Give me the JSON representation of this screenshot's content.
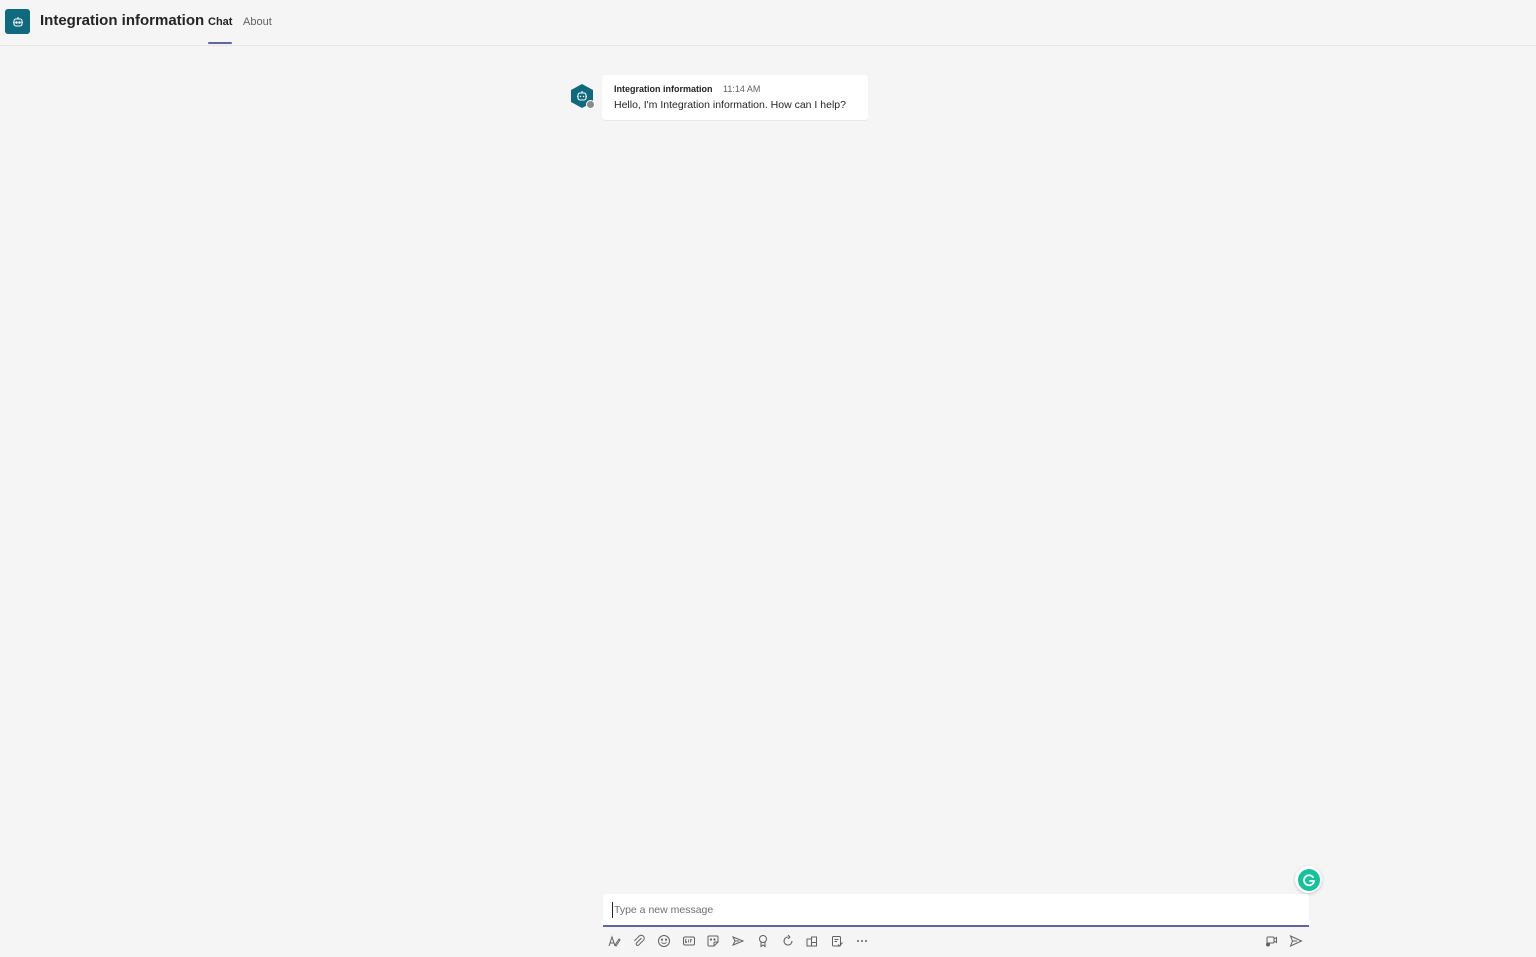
{
  "app": {
    "title": "Integration information",
    "icon": "bot-icon",
    "accent_color": "#0f6a7e"
  },
  "tabs": [
    {
      "label": "Chat",
      "active": true
    },
    {
      "label": "About",
      "active": false
    }
  ],
  "messages": [
    {
      "sender": "Integration information",
      "time": "11:14 AM",
      "text": "Hello, I'm Integration information. How can I help?",
      "avatar_icon": "bot-icon",
      "presence": "offline"
    }
  ],
  "compose": {
    "placeholder": "Type a new message",
    "value": "",
    "focus_color": "#6264a7"
  },
  "toolbar": {
    "left_icons": [
      "format-icon",
      "attach-icon",
      "emoji-icon",
      "gif-icon",
      "sticker-icon",
      "meet-now-icon",
      "praise-icon",
      "loop-icon",
      "apps-icon",
      "approvals-icon",
      "more-icon"
    ],
    "right_icons": [
      "video-clip-icon",
      "send-icon"
    ]
  },
  "extensions": {
    "grammarly_icon": "grammarly-icon"
  }
}
